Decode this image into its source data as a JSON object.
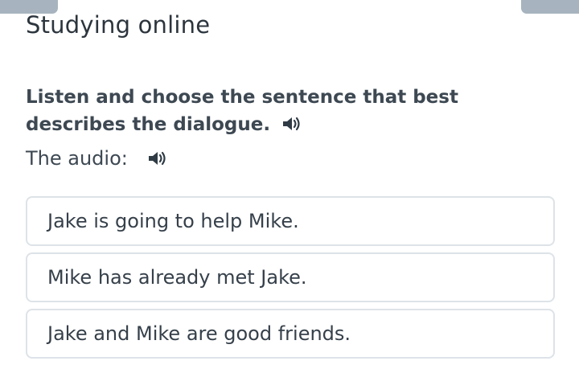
{
  "title": "Studying online",
  "question": {
    "instruction": "Listen and choose the sentence that best describes the dialogue.",
    "instruction_icon": "speaker-icon"
  },
  "audio": {
    "label": "The audio:",
    "icon": "speaker-icon"
  },
  "options": [
    "Jake is going to help Mike.",
    "Mike has already met Jake.",
    "Jake and Mike are good friends."
  ],
  "colors": {
    "text": "#2f3b45",
    "option_border": "#dde3e8",
    "tab": "#a7b4bf"
  }
}
